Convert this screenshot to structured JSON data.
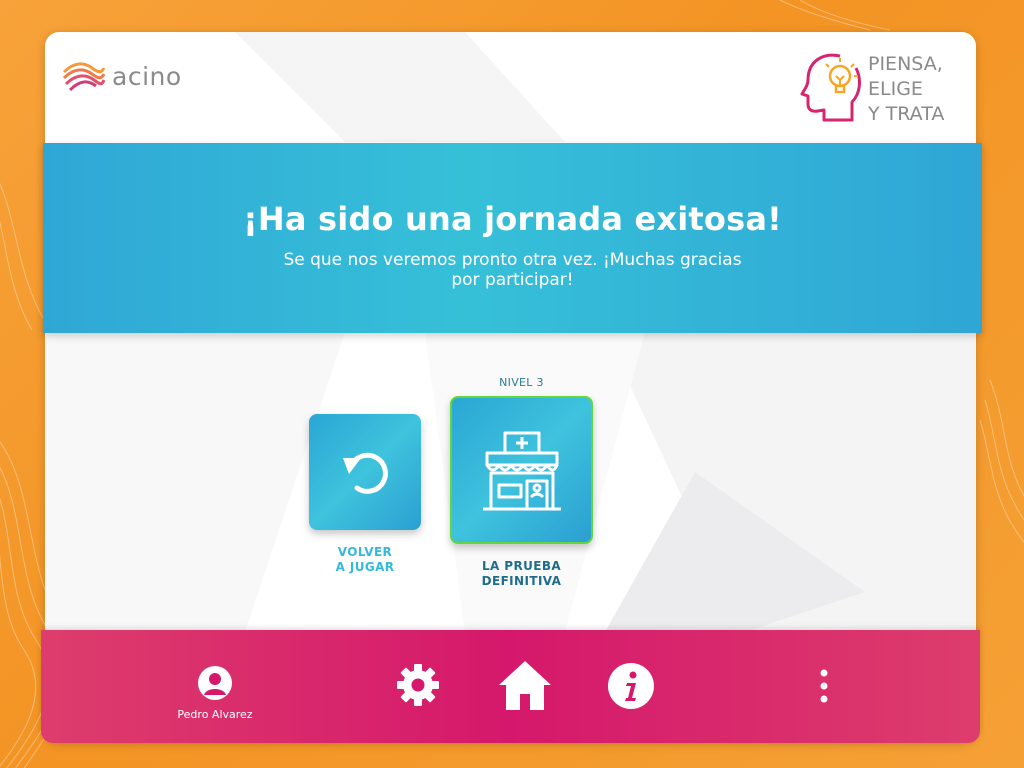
{
  "brand": {
    "company_name": "acino",
    "game_title_lines": [
      "PIENSA,",
      "ELIGE",
      "Y TRATA"
    ],
    "icons": [
      "acino-logo-mark",
      "head-lightbulb-icon"
    ]
  },
  "banner": {
    "title": "¡Ha sido una jornada exitosa!",
    "subtitle": "Se que nos veremos pronto otra vez. ¡Muchas gracias por participar!"
  },
  "options": {
    "retry": {
      "label_line1": "VOLVER",
      "label_line2": "A JUGAR",
      "icon": "undo-arrow-icon"
    },
    "final": {
      "level": "NIVEL 3",
      "label_line1": "LA PRUEBA",
      "label_line2": "DEFINITIVA",
      "icon": "pharmacy-store-icon"
    }
  },
  "footer": {
    "user_name": "Pedro Alvarez",
    "icons": [
      "user-avatar-icon",
      "gear-icon",
      "home-icon",
      "info-icon",
      "more-vertical-icon"
    ]
  },
  "colors": {
    "background_orange": "#f39424",
    "banner_blue": "#2fa7d6",
    "tile_blue": "#2aa6d4",
    "selected_border_green": "#62d63e",
    "footer_magenta": "#d5186b",
    "logo_text_gray": "#8b8b8b"
  }
}
